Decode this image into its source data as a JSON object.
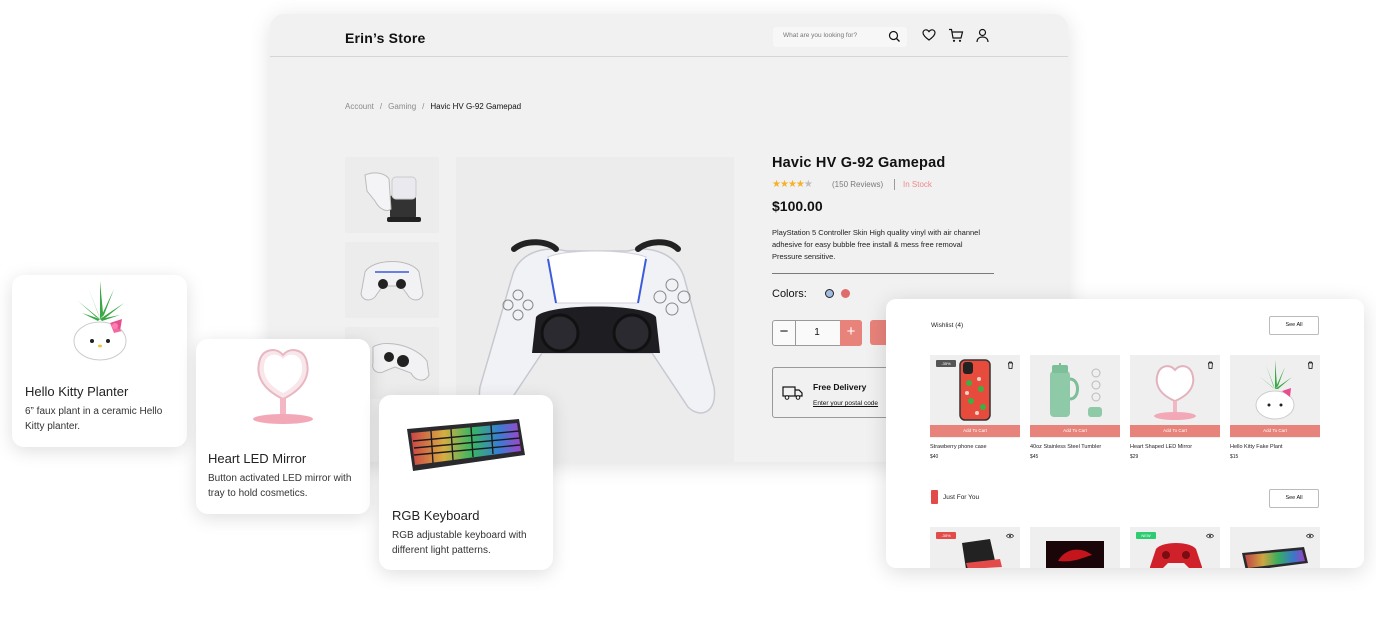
{
  "store": {
    "name": "Erin’s Store",
    "search_placeholder": "What are you looking for?"
  },
  "breadcrumb": {
    "items": [
      "Account",
      "Gaming"
    ],
    "current": "Havic HV G-92 Gamepad",
    "separator": "/"
  },
  "product": {
    "title": "Havic HV G-92 Gamepad",
    "rating": 4,
    "rating_max": 5,
    "reviews": "(150 Reviews)",
    "stock": "In Stock",
    "price": "$100.00",
    "description": "PlayStation 5 Controller Skin High quality vinyl with air channel adhesive for easy bubble free install & mess free removal Pressure sensitive.",
    "colors_label": "Colors:",
    "colors": [
      "#a0bce0",
      "#e06b6b"
    ],
    "quantity": "1",
    "delivery_title": "Free Delivery",
    "delivery_link": "Enter your postal code"
  },
  "cards": [
    {
      "title": "Hello Kitty Planter",
      "desc": "6” faux plant in a ceramic Hello Kitty planter."
    },
    {
      "title": "Heart LED Mirror",
      "desc": "Button activated LED mirror with tray to hold cosmetics."
    },
    {
      "title": "RGB Keyboard",
      "desc": "RGB adjustable keyboard with different light patterns."
    }
  ],
  "wishlist": {
    "title": "Wishlist (4)",
    "see_all": "See All",
    "add_to_cart": "Add To Cart",
    "items": [
      {
        "name": "Strawberry phone case",
        "price": "$40",
        "badge": "-35%"
      },
      {
        "name": "40oz Stainless Steel Tumbler",
        "price": "$45"
      },
      {
        "name": "Heart Shaped LED Mirror",
        "price": "$29"
      },
      {
        "name": "Hello Kitty Fake Plant",
        "price": "$15"
      }
    ]
  },
  "just_for_you": {
    "title": "Just For You",
    "see_all": "See All",
    "badges": [
      "-35%",
      "NEW"
    ]
  },
  "colors": {
    "accent": "#e8837b",
    "star": "#f5b12a",
    "badge_red": "#e34b4b",
    "badge_green": "#2ecc71"
  }
}
